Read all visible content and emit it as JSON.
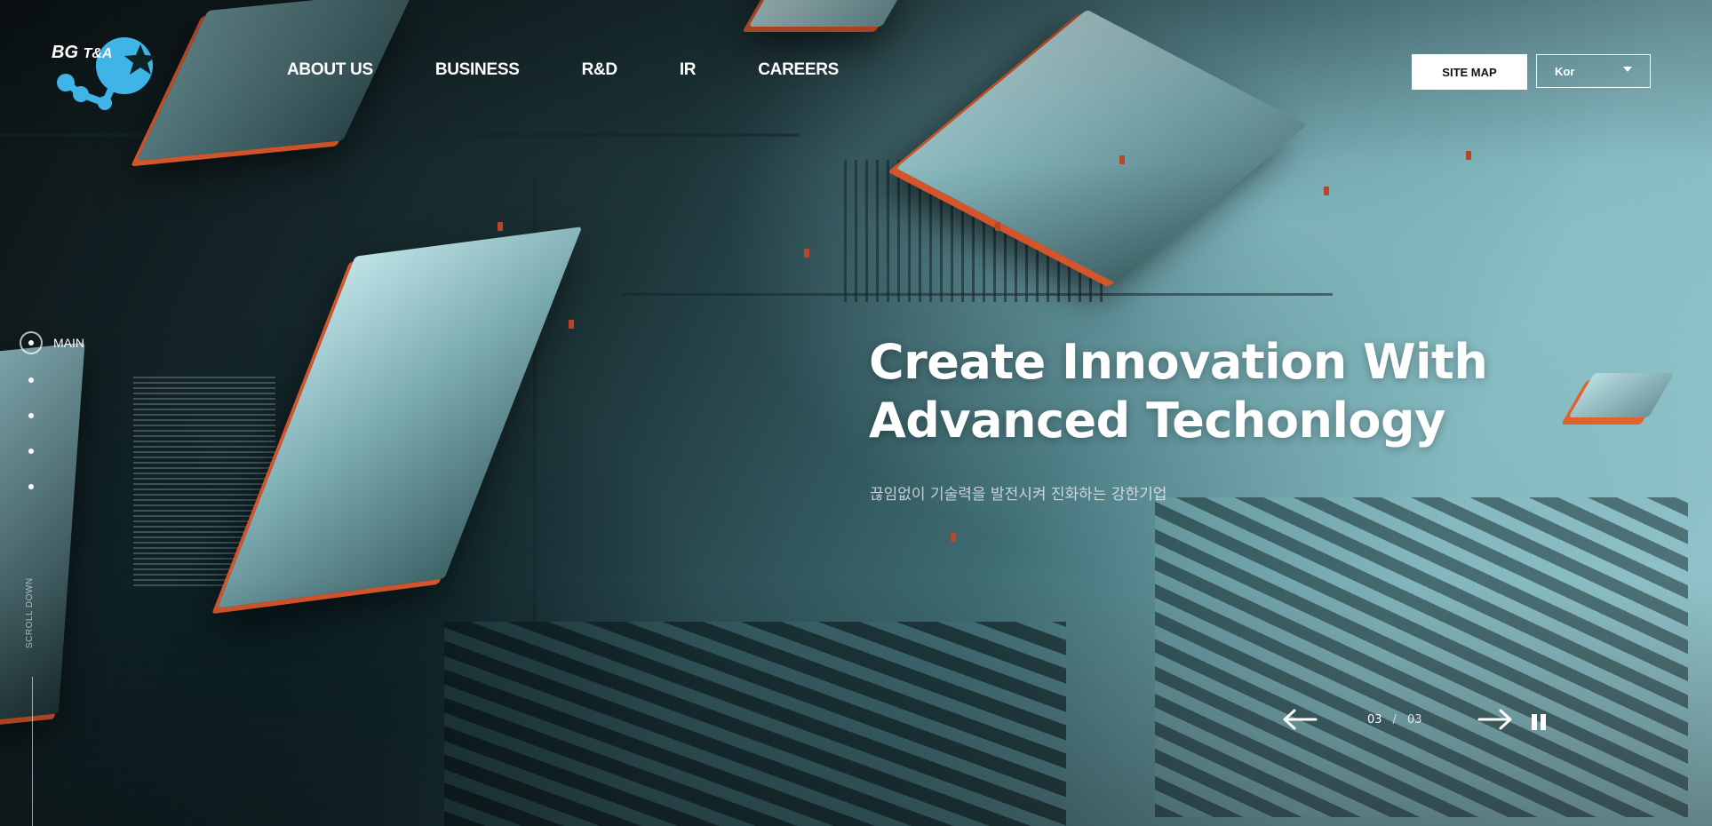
{
  "brand": {
    "logo_text": "BG",
    "logo_small": "T&A",
    "accent": "#3fb4e6"
  },
  "nav": {
    "items": [
      {
        "label": "ABOUT US"
      },
      {
        "label": "BUSINESS"
      },
      {
        "label": "R&D"
      },
      {
        "label": "IR"
      },
      {
        "label": "CAREERS"
      }
    ]
  },
  "header": {
    "sitemap_label": "SITE MAP",
    "language": {
      "selected": "Kor"
    }
  },
  "side_nav": {
    "label": "MAIN"
  },
  "scroll_label": "SCROLL DOWN",
  "hero": {
    "title_line1": "Create Innovation With",
    "title_line2": "Advanced Techonlogy",
    "subtitle": "끊임없이 기술력을 발전시켜 진화하는 강한기업"
  },
  "slider": {
    "current": "03",
    "separator": "/",
    "total": "03"
  },
  "colors": {
    "trace_accent": "#d3552b",
    "text": "#ffffff"
  }
}
